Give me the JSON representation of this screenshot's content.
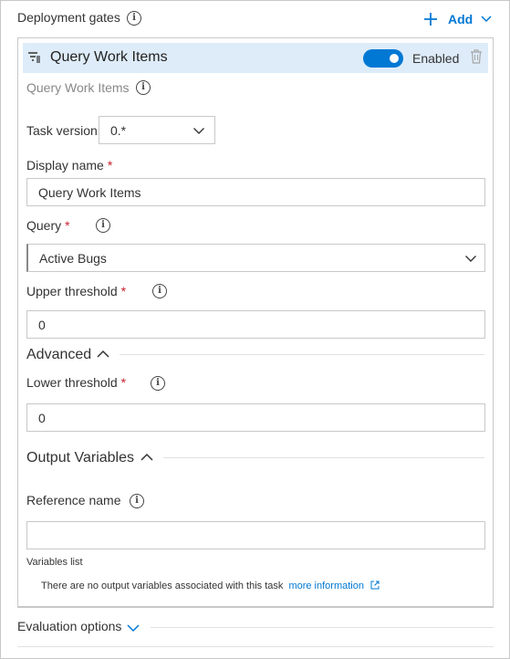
{
  "header": {
    "title": "Deployment gates",
    "add_label": "Add"
  },
  "gate": {
    "title": "Query Work Items",
    "toggle_label": "Enabled",
    "subtitle": "Query Work Items",
    "task_version_label": "Task version",
    "task_version_value": "0.*",
    "display_name_label": "Display name",
    "display_name_value": "Query Work Items",
    "query_label": "Query",
    "query_value": "Active Bugs",
    "upper_label": "Upper threshold",
    "upper_value": "0",
    "advanced_label": "Advanced",
    "lower_label": "Lower threshold",
    "lower_value": "0",
    "output_label": "Output Variables",
    "ref_label": "Reference name",
    "ref_value": "",
    "vars_list_label": "Variables list",
    "no_vars_text": "There are no output variables associated with this task",
    "more_info_link": "more information"
  },
  "footer": {
    "evaluation_label": "Evaluation options"
  },
  "colors": {
    "accent": "#0078d4",
    "header_bg": "#deecf9",
    "required": "#c8202d"
  }
}
